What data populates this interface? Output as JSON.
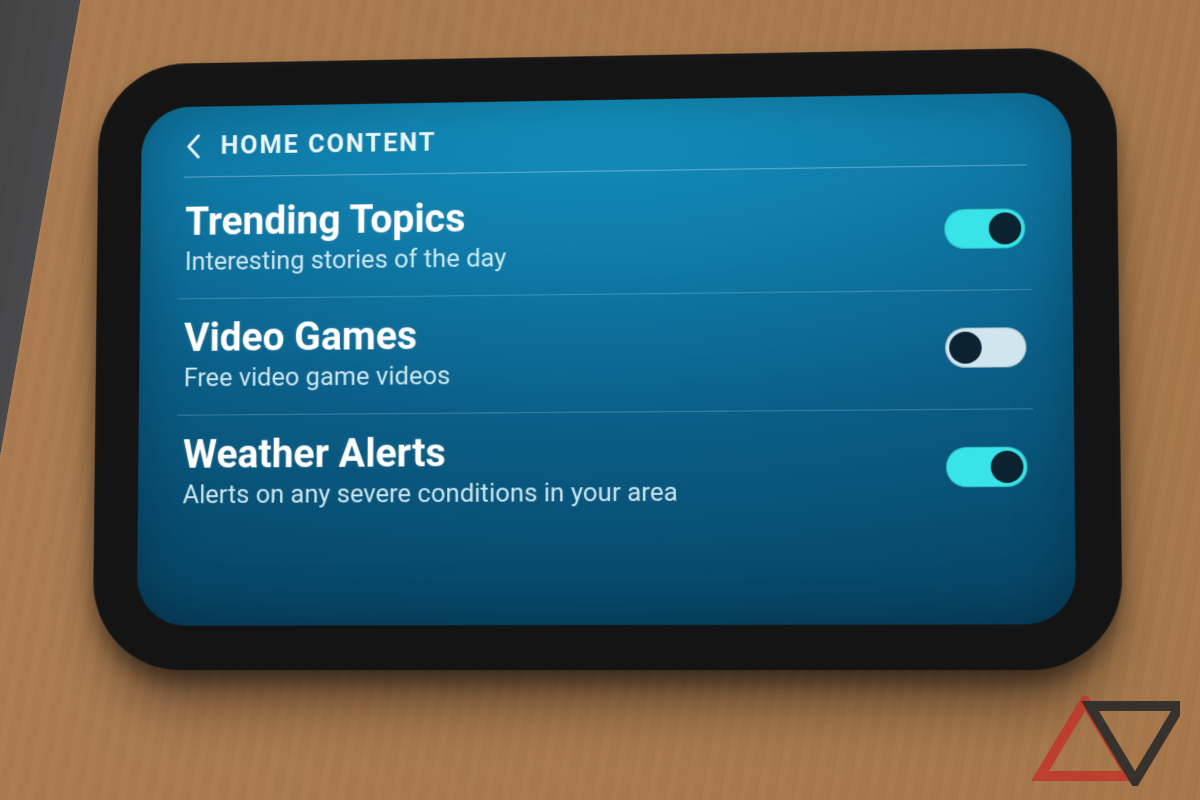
{
  "header": {
    "title": "HOME CONTENT"
  },
  "items": [
    {
      "title": "Trending Topics",
      "subtitle": "Interesting stories of the day",
      "enabled": true
    },
    {
      "title": "Video Games",
      "subtitle": "Free video game videos",
      "enabled": false
    },
    {
      "title": "Weather Alerts",
      "subtitle": "Alerts on any severe conditions in your area",
      "enabled": true
    }
  ],
  "colors": {
    "toggle_on": "#39e4e8",
    "toggle_off": "#cfe6ee",
    "screen_top": "#1499c6",
    "screen_bottom": "#063f5e"
  }
}
